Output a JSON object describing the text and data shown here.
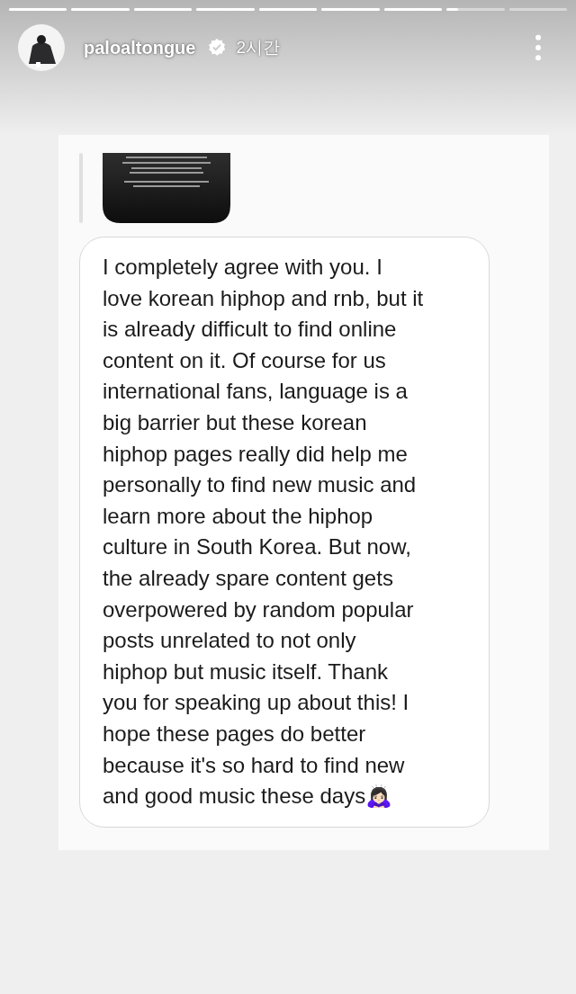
{
  "progress": [
    {
      "level": 1
    },
    {
      "level": 1
    },
    {
      "level": 1
    },
    {
      "level": 1
    },
    {
      "level": 1
    },
    {
      "level": 1
    },
    {
      "level": 1
    },
    {
      "level": 0.2
    }
  ],
  "header": {
    "username": "paloaltongue",
    "verified": true,
    "time": "2시간"
  },
  "message": {
    "text": "I completely agree with you. I\nlove korean hiphop and rnb, but it\nis already difficult to find online\ncontent on it. Of course for us\ninternational fans, language is a\nbig barrier but these korean\nhiphop pages really did help me\npersonally to find new music and\nlearn more about the hiphop\nculture in South Korea. But now,\nthe already spare content gets\noverpowered by random popular\nposts unrelated to not only\nhiphop but music itself. Thank\nyou for speaking up about this! I\nhope these pages do better\nbecause it's so hard to find new\nand good music these days🙇🏻‍♀️"
  }
}
